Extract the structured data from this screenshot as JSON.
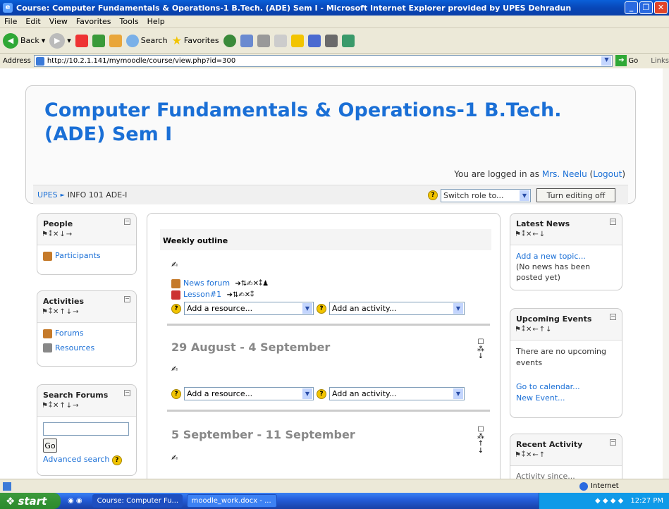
{
  "window": {
    "title": "Course: Computer Fundamentals & Operations-1 B.Tech. (ADE) Sem I - Microsoft Internet Explorer provided by UPES Dehradun"
  },
  "menu": [
    "File",
    "Edit",
    "View",
    "Favorites",
    "Tools",
    "Help"
  ],
  "toolbar": {
    "back": "Back",
    "search": "Search",
    "favorites": "Favorites"
  },
  "address": {
    "label": "Address",
    "url": "http://10.2.1.141/mymoodle/course/view.php?id=300",
    "go": "Go",
    "links": "Links"
  },
  "page": {
    "title": "Computer Fundamentals & Operations-1 B.Tech. (ADE) Sem I",
    "login_prefix": "You are logged in as ",
    "login_user": "Mrs. Neelu",
    "logout": "Logout",
    "breadcrumb_root": "UPES",
    "breadcrumb_sep": "►",
    "breadcrumb_course": "INFO 101 ADE-I",
    "switch_role": "Switch role to...",
    "editing_button": "Turn editing off"
  },
  "blocks": {
    "people": {
      "title": "People",
      "participants": "Participants"
    },
    "activities": {
      "title": "Activities",
      "forums": "Forums",
      "resources": "Resources"
    },
    "search": {
      "title": "Search Forums",
      "go": "Go",
      "advanced": "Advanced search"
    },
    "news": {
      "title": "Latest News",
      "add": "Add a new topic...",
      "none": "(No news has been posted yet)"
    },
    "events": {
      "title": "Upcoming Events",
      "none": "There are no upcoming events",
      "calendar": "Go to calendar...",
      "new": "New Event..."
    },
    "recent": {
      "title": "Recent Activity",
      "since": "Activity since..."
    }
  },
  "main": {
    "outline": "Weekly outline",
    "news_forum": "News forum",
    "lesson": "Lesson#1",
    "add_resource": "Add a resource...",
    "add_activity": "Add an activity...",
    "week1": "29 August - 4 September",
    "week2": "5 September - 11 September"
  },
  "status": {
    "zone": "Internet"
  },
  "taskbar": {
    "start": "start",
    "task1": "Course: Computer Fu...",
    "task2": "moodle_work.docx - ...",
    "time": "12:27 PM"
  }
}
